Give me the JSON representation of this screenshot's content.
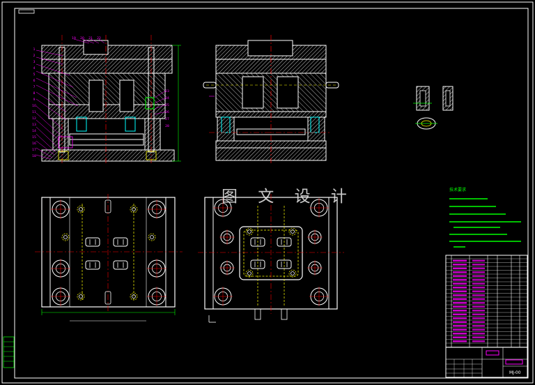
{
  "drawing": {
    "watermark_text": "图 文 设 计",
    "tech_notes_title": "技术要求",
    "drawing_number": "MJ-00"
  },
  "colors": {
    "background": "#000000",
    "outline": "#ffffff",
    "hatch": "#ffffff",
    "centerline": "#ff0000",
    "dimension": "#00ff00",
    "hidden_line": "#ffff00",
    "annotation": "#ff00ff",
    "title_block_highlight": "#ff00ff"
  },
  "views": [
    {
      "id": "front-section",
      "kind": "sectional-view"
    },
    {
      "id": "side-section",
      "kind": "sectional-view"
    },
    {
      "id": "detail-insert",
      "kind": "detail-view"
    },
    {
      "id": "fixed-half-plan",
      "kind": "plan-view"
    },
    {
      "id": "moving-half-plan",
      "kind": "plan-view"
    },
    {
      "id": "technical-notes",
      "kind": "notes"
    },
    {
      "id": "parts-list",
      "kind": "bill-of-materials"
    },
    {
      "id": "title-block",
      "kind": "title-block"
    }
  ],
  "part_balloons": [
    "19",
    "20",
    "21",
    "22",
    "23",
    "24",
    "25",
    "26",
    "27",
    "28",
    "1",
    "2",
    "3",
    "4",
    "5",
    "6",
    "7",
    "8",
    "9",
    "10",
    "11",
    "12",
    "13",
    "14",
    "15",
    "16",
    "17",
    "18"
  ]
}
